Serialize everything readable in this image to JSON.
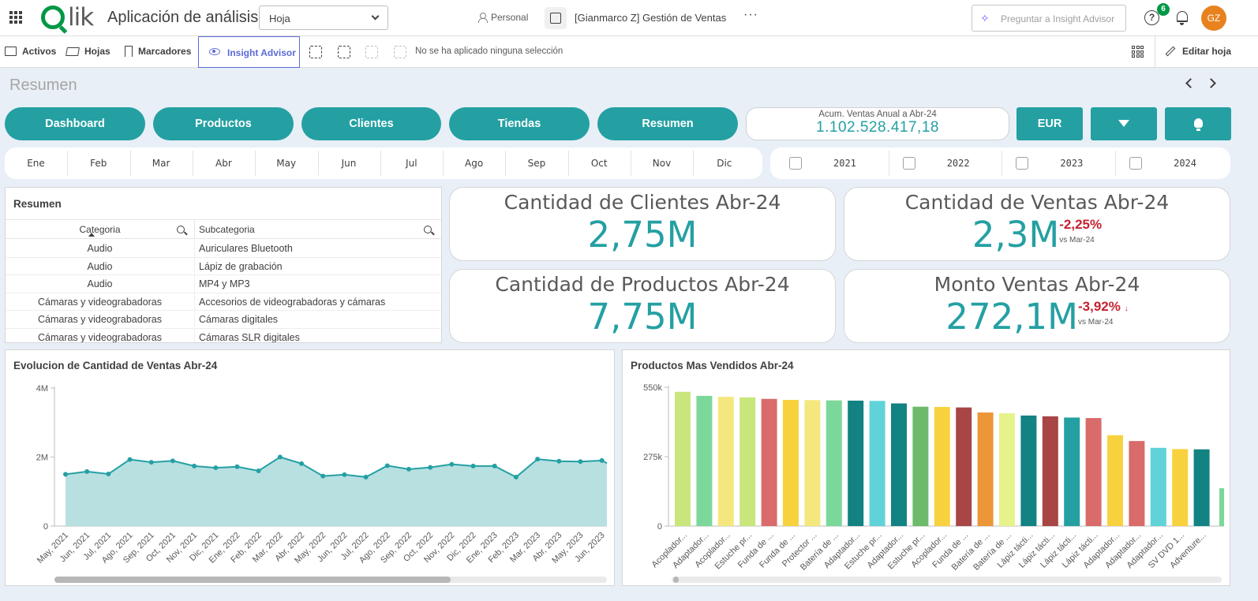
{
  "topbar": {
    "app_title": "Aplicación de análisis",
    "sheet_select": "Hoja",
    "space": "Personal",
    "app_name": "[Gianmarco Z] Gestión de Ventas",
    "more": "···",
    "ask_placeholder": "Preguntar a Insight Advisor",
    "notification_count": "6",
    "avatar_initials": "GZ",
    "help_glyph": "?"
  },
  "toolbar": {
    "activos": "Activos",
    "hojas": "Hojas",
    "marcadores": "Marcadores",
    "insight": "Insight Advisor",
    "no_selection": "No se ha aplicado ninguna selección",
    "edit_sheet": "Editar hoja"
  },
  "sheet": {
    "title": "Resumen"
  },
  "nav_buttons": [
    "Dashboard",
    "Productos",
    "Clientes",
    "Tiendas",
    "Resumen"
  ],
  "acum": {
    "label": "Acum. Ventas Anual a Abr-24",
    "value": "1.102.528.417,18"
  },
  "currency_button": "EUR",
  "months": [
    "Ene",
    "Feb",
    "Mar",
    "Abr",
    "May",
    "Jun",
    "Jul",
    "Ago",
    "Sep",
    "Oct",
    "Nov",
    "Dic"
  ],
  "years": [
    "2021",
    "2022",
    "2023",
    "2024"
  ],
  "table": {
    "title": "Resumen",
    "col_categoria": "Categoria",
    "col_subcategoria": "Subcategoria",
    "rows": [
      {
        "cat": "Audio",
        "sub": "Auriculares Bluetooth"
      },
      {
        "cat": "Audio",
        "sub": "Lápiz de grabación"
      },
      {
        "cat": "Audio",
        "sub": "MP4 y MP3"
      },
      {
        "cat": "Cámaras y videograbadoras",
        "sub": "Accesorios de videograbadoras y cámaras"
      },
      {
        "cat": "Cámaras y videograbadoras",
        "sub": "Cámaras digitales"
      },
      {
        "cat": "Cámaras y videograbadoras",
        "sub": "Cámaras SLR digitales"
      }
    ]
  },
  "kpis": {
    "clientes": {
      "title": "Cantidad de Clientes Abr-24",
      "value": "2,75M"
    },
    "ventas": {
      "title": "Cantidad de Ventas Abr-24",
      "value": "2,3M",
      "delta": "-2,25%",
      "vs": "vs Mar-24"
    },
    "productos": {
      "title": "Cantidad de Productos Abr-24",
      "value": "7,75M"
    },
    "monto": {
      "title": "Monto Ventas Abr-24",
      "value": "272,1M",
      "delta": "-3,92%",
      "vs": "vs Mar-24",
      "arrow": "↓"
    }
  },
  "colors": {
    "teal": "#24a0a3",
    "negative": "#c6222e",
    "area_fill": "#b8e0e1"
  },
  "chart_data": [
    {
      "type": "area",
      "title": "Evolucion de Cantidad de Ventas Abr-24",
      "y_ticks": [
        "0",
        "2M",
        "4M"
      ],
      "ylim": [
        0,
        4000000
      ],
      "x": [
        "May, 2021",
        "Jun, 2021",
        "Jul, 2021",
        "Ago, 2021",
        "Sep, 2021",
        "Oct, 2021",
        "Nov, 2021",
        "Dic, 2021",
        "Ene, 2022",
        "Feb, 2022",
        "Mar, 2022",
        "Abr, 2022",
        "May, 2022",
        "Jun, 2022",
        "Jul, 2022",
        "Ago, 2022",
        "Sep, 2022",
        "Oct, 2022",
        "Nov, 2022",
        "Dic, 2022",
        "Ene, 2023",
        "Feb, 2023",
        "Mar, 2023",
        "Abr, 2023",
        "May, 2023",
        "Jun, 2023"
      ],
      "values": [
        1500000,
        1580000,
        1510000,
        1930000,
        1850000,
        1890000,
        1740000,
        1690000,
        1720000,
        1600000,
        2000000,
        1810000,
        1450000,
        1490000,
        1420000,
        1750000,
        1650000,
        1700000,
        1790000,
        1740000,
        1740000,
        1420000,
        1940000,
        1880000,
        1870000,
        1900000
      ],
      "grid": false
    },
    {
      "type": "bar",
      "title": "Productos Mas Vendidos Abr-24",
      "y_ticks": [
        "0",
        "275k",
        "550k"
      ],
      "ylim": [
        0,
        550000
      ],
      "categories": [
        "Acoplador...",
        "Adaptador...",
        "Acoplador...",
        "Estuche pr...",
        "Funda de ...",
        "Funda de ...",
        "Protector ...",
        "Batería de ...",
        "Adaptador...",
        "Estuche pr...",
        "Adaptador...",
        "Estuche pr...",
        "Acoplador...",
        "Funda de ...",
        "Batería de ...",
        "Batería de ...",
        "Lápiz tácti...",
        "Lápiz tácti...",
        "Lápiz tácti...",
        "Lápiz tácti...",
        "Adaptador...",
        "Adaptador...",
        "Adaptador...",
        "SV DVD 1...",
        "Adventure..."
      ],
      "values": [
        532000,
        516000,
        512000,
        510000,
        504000,
        500000,
        499000,
        498000,
        497000,
        496000,
        486000,
        473000,
        472000,
        470000,
        450000,
        447000,
        438000,
        435000,
        430000,
        428000,
        360000,
        337000,
        310000,
        305000,
        304000
      ],
      "colors": [
        "#c8e67c",
        "#7bd89a",
        "#f4e77e",
        "#c8e67c",
        "#d96b6b",
        "#f8d23e",
        "#f4e77e",
        "#7bd89a",
        "#128282",
        "#5fd3d8",
        "#128282",
        "#6dbb6a",
        "#f8d23e",
        "#a84545",
        "#ec9638",
        "#e6f38c",
        "#128282",
        "#a84545",
        "#24a0a3",
        "#d96b6b",
        "#f8d23e",
        "#d96b6b",
        "#5fd3d8",
        "#f8d23e",
        "#128282"
      ],
      "grid": false
    }
  ]
}
